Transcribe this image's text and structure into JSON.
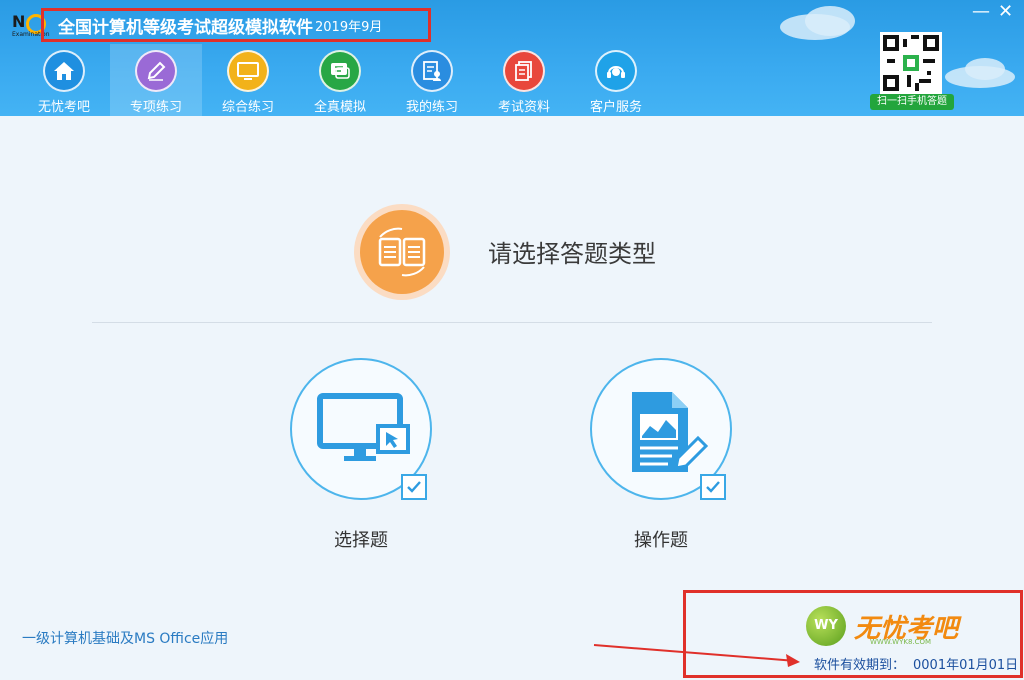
{
  "app": {
    "logo_letters": "N",
    "logo_sub": "Examination",
    "title": "全国计算机等级考试超级模拟软件",
    "title_date": "2019年9月",
    "minimize_glyph": "—",
    "close_glyph": "✕"
  },
  "nav": {
    "items": [
      {
        "label": "无忧考吧",
        "icon": "home-icon",
        "color": "#1f8fe0"
      },
      {
        "label": "专项练习",
        "icon": "pencil-icon",
        "color": "#9a6ad6"
      },
      {
        "label": "综合练习",
        "icon": "monitor-icon",
        "color": "#f2b21a"
      },
      {
        "label": "全真模拟",
        "icon": "chat-icon",
        "color": "#28a745"
      },
      {
        "label": "我的练习",
        "icon": "document-user-icon",
        "color": "#2a8de0"
      },
      {
        "label": "考试资料",
        "icon": "files-icon",
        "color": "#e8473b"
      },
      {
        "label": "客户服务",
        "icon": "headset-icon",
        "color": "#1fa2e8"
      }
    ],
    "active_index": 1
  },
  "qr": {
    "hint": "扫一扫手机答题"
  },
  "main": {
    "prompt": "请选择答题类型",
    "choices": [
      {
        "label": "选择题",
        "icon": "monitor-cursor-icon"
      },
      {
        "label": "操作题",
        "icon": "document-chart-icon"
      }
    ]
  },
  "footer": {
    "subject": "一级计算机基础及MS Office应用",
    "brand_ball": "WY",
    "brand_name": "无忧考吧",
    "brand_url": "WWW.WYK8.COM",
    "valid_label": "软件有效期到：",
    "valid_date": "0001年01月01日"
  },
  "colors": {
    "header": "#2a9be4",
    "accent_blue": "#4db5ec",
    "annotation_red": "#e0302a",
    "brand_orange": "#f28a10"
  }
}
